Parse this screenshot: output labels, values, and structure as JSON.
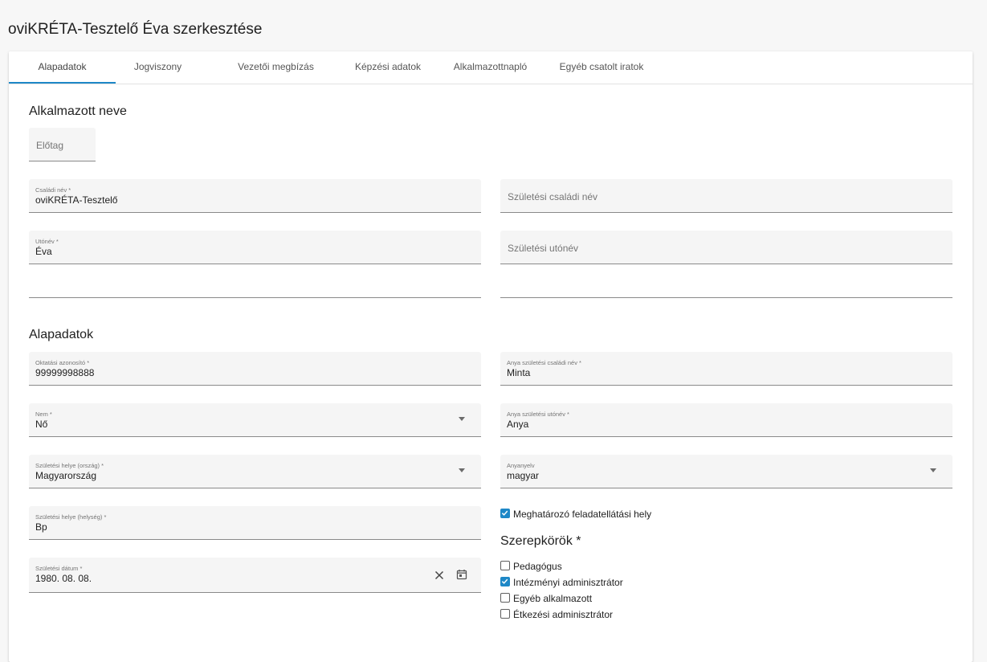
{
  "page": {
    "title": "oviKRÉTA-Tesztelő Éva szerkesztése"
  },
  "tabs": [
    {
      "label": "Alapadatok"
    },
    {
      "label": "Jogviszony"
    },
    {
      "label": "Vezetői megbízás"
    },
    {
      "label": "Képzési adatok"
    },
    {
      "label": "Alkalmazottnapló"
    },
    {
      "label": "Egyéb csatolt iratok"
    }
  ],
  "name_section": {
    "title": "Alkalmazott neve",
    "prefix": {
      "placeholder": "Előtag"
    },
    "family_name": {
      "label": "Családi név *",
      "value": "oviKRÉTA-Tesztelő"
    },
    "birth_family_name": {
      "placeholder": "Születési családi név"
    },
    "given_name": {
      "label": "Utónév *",
      "value": "Éva"
    },
    "birth_given_name": {
      "placeholder": "Születési utónév"
    }
  },
  "basic_section": {
    "title": "Alapadatok",
    "education_id": {
      "label": "Oktatási azonosító *",
      "value": "99999998888"
    },
    "mother_family_name": {
      "label": "Anya születési családi név *",
      "value": "Minta"
    },
    "gender": {
      "label": "Nem *",
      "value": "Nő"
    },
    "mother_given_name": {
      "label": "Anya születési utónév *",
      "value": "Anya"
    },
    "birth_country": {
      "label": "Születési helye (ország) *",
      "value": "Magyarország"
    },
    "mother_tongue": {
      "label": "Anyanyelv",
      "value": "magyar"
    },
    "birth_city": {
      "label": "Születési helye (helység) *",
      "value": "Bp"
    },
    "birth_date": {
      "label": "Születési dátum *",
      "value": "1980. 08. 08."
    },
    "primary_site": {
      "label": "Meghatározó feladatellátási hely",
      "checked": true
    }
  },
  "roles": {
    "title": "Szerepkörök *",
    "items": [
      {
        "label": "Pedagógus",
        "checked": false
      },
      {
        "label": "Intézményi adminisztrátor",
        "checked": true
      },
      {
        "label": "Egyéb alkalmazott",
        "checked": false
      },
      {
        "label": "Étkezési adminisztrátor",
        "checked": false
      }
    ]
  },
  "icons": {
    "dropdown": "chevron-down-icon",
    "clear": "close-icon",
    "calendar": "calendar-icon",
    "checkbox_checked": "check-icon"
  },
  "colors": {
    "accent": "#1e88c7",
    "field_bg": "#f5f5f5"
  }
}
